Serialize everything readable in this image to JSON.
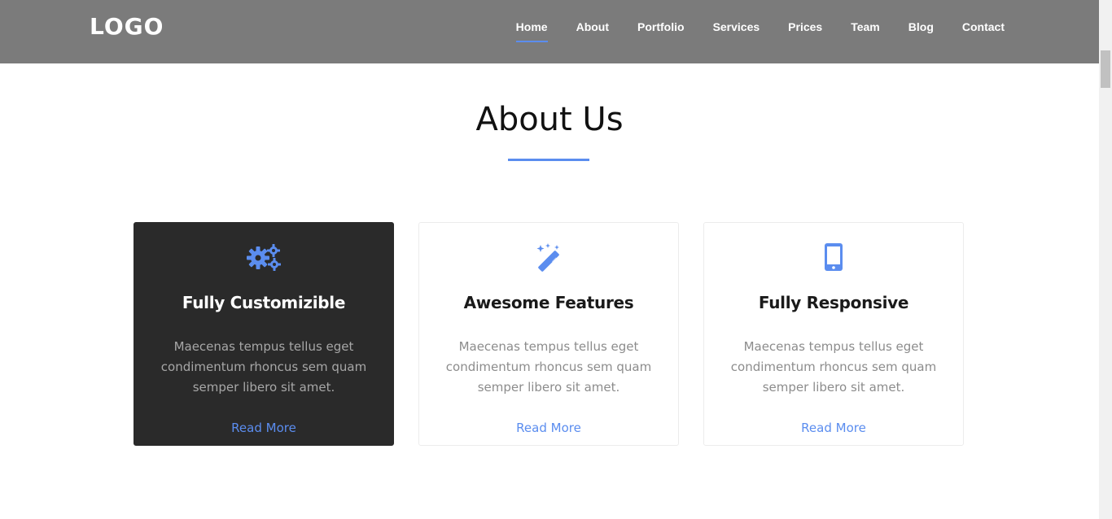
{
  "header": {
    "logo": "LOGO",
    "nav": [
      {
        "label": "Home",
        "active": true
      },
      {
        "label": "About"
      },
      {
        "label": "Portfolio"
      },
      {
        "label": "Services"
      },
      {
        "label": "Prices"
      },
      {
        "label": "Team"
      },
      {
        "label": "Blog"
      },
      {
        "label": "Contact"
      }
    ]
  },
  "about": {
    "title": "About Us",
    "cards": [
      {
        "icon": "gears-icon",
        "title": "Fully Customizible",
        "text": "Maecenas tempus tellus eget condimentum rhoncus sem quam semper libero sit amet.",
        "link": "Read More"
      },
      {
        "icon": "magic-wand-icon",
        "title": "Awesome Features",
        "text": "Maecenas tempus tellus eget condimentum rhoncus sem quam semper libero sit amet.",
        "link": "Read More"
      },
      {
        "icon": "mobile-phone-icon",
        "title": "Fully Responsive",
        "text": "Maecenas tempus tellus eget condimentum rhoncus sem quam semper libero sit amet.",
        "link": "Read More"
      }
    ]
  },
  "colors": {
    "header_bg": "#7b7b7b",
    "accent": "#5b8def",
    "dark_card": "#2a2a2a"
  }
}
